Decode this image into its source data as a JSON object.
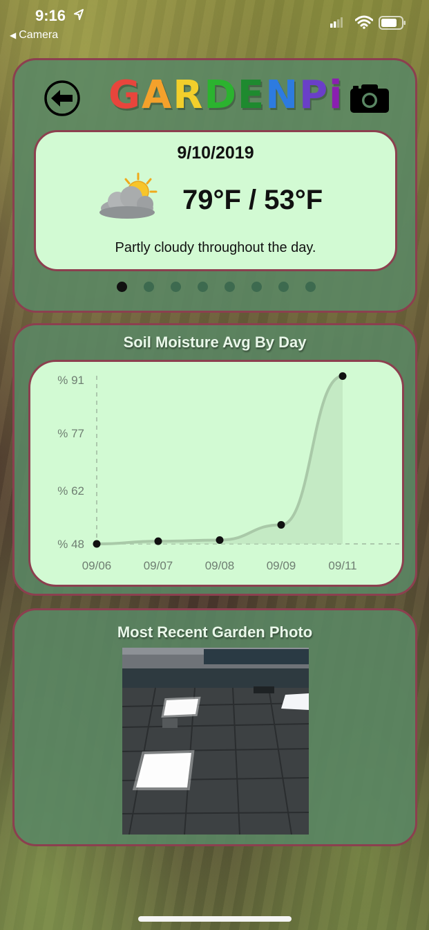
{
  "status_bar": {
    "time": "9:16",
    "back_app_label": "Camera",
    "icons": [
      "location-arrow-icon",
      "signal-icon",
      "wifi-icon",
      "battery-icon"
    ]
  },
  "header": {
    "logo_text": "GARDENPi",
    "logo_colors": [
      "#e8453c",
      "#f4a12b",
      "#f2cf2b",
      "#2bb32f",
      "#1e8a2f",
      "#2d7be0",
      "#6a3fc8",
      "#8a1fb0"
    ],
    "back_icon": "back-arrow-icon",
    "camera_icon": "camera-icon"
  },
  "weather": {
    "date": "9/10/2019",
    "temps": "79°F / 53°F",
    "description": "Partly cloudy throughout the day.",
    "icon": "partly-cloudy-icon",
    "page_count": 8,
    "active_page": 0
  },
  "chart_section": {
    "title": "Soil Moisture Avg By Day"
  },
  "chart_data": {
    "type": "line",
    "title": "Soil Moisture Avg By Day",
    "categories": [
      "09/06",
      "09/07",
      "09/08",
      "09/09",
      "09/11"
    ],
    "values": [
      48,
      48.7,
      49,
      53,
      92
    ],
    "y_ticks": [
      {
        "value": 91,
        "label": "% 91"
      },
      {
        "value": 77,
        "label": "% 77"
      },
      {
        "value": 62,
        "label": "% 62"
      },
      {
        "value": 48,
        "label": "% 48"
      }
    ],
    "ylim": [
      48,
      91
    ],
    "grid": false,
    "series_color": "#a9c9a8",
    "fill_color": "#bde3bd"
  },
  "photo_section": {
    "title": "Most Recent Garden Photo"
  },
  "colors": {
    "card_bg": "#5a8764",
    "panel_bg": "#d2fad3",
    "border": "#8c3f4f"
  }
}
